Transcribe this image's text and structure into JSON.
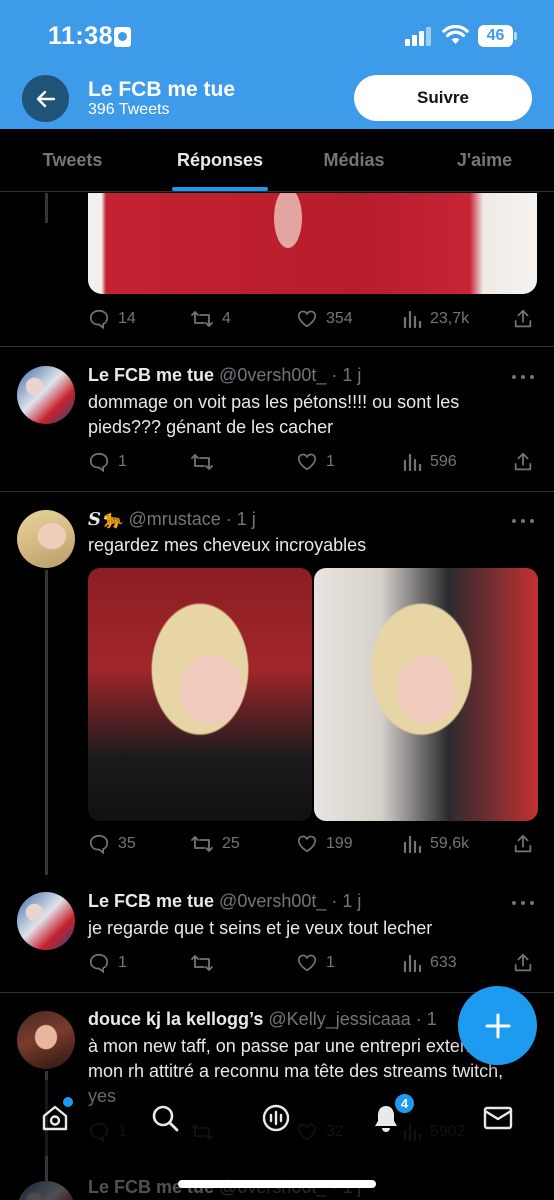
{
  "status_bar": {
    "time": "11:38",
    "battery": "46"
  },
  "header": {
    "title": "Le FCB me tue",
    "subtitle": "396 Tweets",
    "follow_label": "Suivre"
  },
  "tabs": [
    {
      "label": "Tweets",
      "active": false
    },
    {
      "label": "Réponses",
      "active": true
    },
    {
      "label": "Médias",
      "active": false
    },
    {
      "label": "J'aime",
      "active": false
    }
  ],
  "tweets": [
    {
      "id": "t0",
      "name": "",
      "handle": "",
      "text": "",
      "stats": {
        "replies": "14",
        "retweets": "4",
        "likes": "354",
        "views": "23,7k"
      }
    },
    {
      "id": "t1",
      "name": "Le FCB me tue",
      "handle": "@0versh00t_",
      "time": "1 j",
      "text": "dommage on voit pas les pétons!!!! ou sont les pieds??? génant de les cacher",
      "stats": {
        "replies": "1",
        "retweets": "",
        "likes": "1",
        "views": "596"
      }
    },
    {
      "id": "t2",
      "name": "S🐆",
      "handle": "@mrustace",
      "time": "1 j",
      "text": "regardez mes cheveux incroyables",
      "stats": {
        "replies": "35",
        "retweets": "25",
        "likes": "199",
        "views": "59,6k"
      }
    },
    {
      "id": "t3",
      "name": "Le FCB me tue",
      "handle": "@0versh00t_",
      "time": "1 j",
      "text": "je regarde que t seins et je veux tout lecher",
      "stats": {
        "replies": "1",
        "retweets": "",
        "likes": "1",
        "views": "633"
      }
    },
    {
      "id": "t4",
      "name": "douce kj la kellogg’s",
      "handle": "@Kelly_jessicaaa",
      "time": "1",
      "text": "à mon new taff, on passe par une entrepri externe, mon rh attitré a reconnu ma tête des streams twitch, yes",
      "stats": {
        "replies": "1",
        "retweets": "",
        "likes": "32",
        "views": "5902"
      }
    },
    {
      "id": "t5",
      "name": "Le FCB me tue",
      "handle": "@0versh00t_",
      "time": "1 j"
    }
  ],
  "bottom_nav": {
    "items": [
      "home-icon",
      "search-icon",
      "spaces-icon",
      "notifications-icon",
      "messages-icon"
    ],
    "notifications_count": "4"
  },
  "colors": {
    "accent": "#1d9bf0",
    "header_bg": "#3d9be9",
    "background": "#000000",
    "muted": "#71767b"
  }
}
